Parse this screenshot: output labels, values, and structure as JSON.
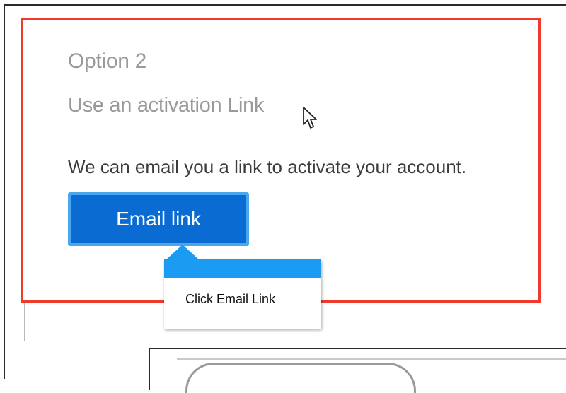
{
  "option": {
    "title": "Option 2",
    "subtitle": "Use an activation Link",
    "description": "We can email you a link to activate your account."
  },
  "email_button": {
    "label": "Email link"
  },
  "tooltip": {
    "text": "Click Email Link"
  },
  "colors": {
    "highlight": "#ee3a2b",
    "button": "#0a6cd3",
    "button_border": "#4aa7ee",
    "tooltip_bar": "#1b9cf2"
  },
  "icons": {
    "cursor": "arrow-cursor-icon"
  }
}
